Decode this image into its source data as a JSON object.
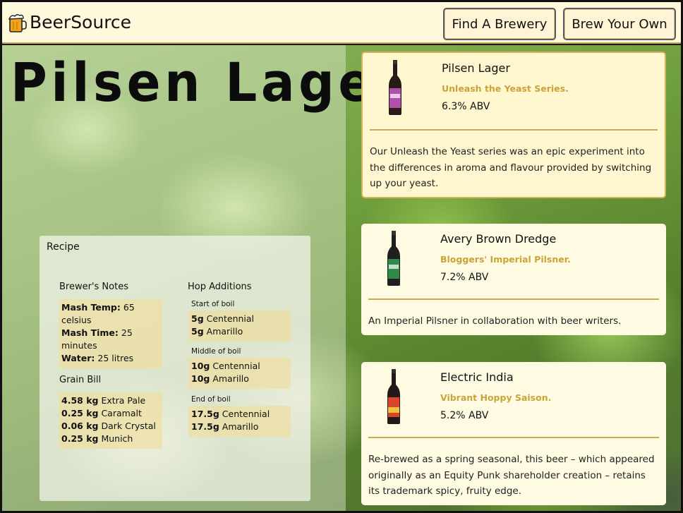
{
  "app": {
    "brand": "BeerSource",
    "logo_icon": "beer-mug-icon"
  },
  "nav": {
    "find_brewery": "Find A Brewery",
    "brew_your_own": "Brew Your Own"
  },
  "page": {
    "title": "Pilsen Lager"
  },
  "recipe": {
    "title": "Recipe",
    "brewers_notes": {
      "title": "Brewer's Notes",
      "mash_temp_label": "Mash Temp:",
      "mash_temp_value": "65 celsius",
      "mash_time_label": "Mash Time:",
      "mash_time_value": "25 minutes",
      "water_label": "Water:",
      "water_value": "25 litres"
    },
    "grain_bill": {
      "title": "Grain Bill",
      "items": [
        {
          "qty": "4.58 kg",
          "name": "Extra Pale"
        },
        {
          "qty": "0.25 kg",
          "name": "Caramalt"
        },
        {
          "qty": "0.06 kg",
          "name": "Dark Crystal"
        },
        {
          "qty": "0.25 kg",
          "name": "Munich"
        }
      ]
    },
    "hop_additions": {
      "title": "Hop Additions",
      "stages": [
        {
          "label": "Start of boil",
          "items": [
            {
              "qty": "5g",
              "name": "Centennial"
            },
            {
              "qty": "5g",
              "name": "Amarillo"
            }
          ]
        },
        {
          "label": "Middle of boil",
          "items": [
            {
              "qty": "10g",
              "name": "Centennial"
            },
            {
              "qty": "10g",
              "name": "Amarillo"
            }
          ]
        },
        {
          "label": "End of boil",
          "items": [
            {
              "qty": "17.5g",
              "name": "Centennial"
            },
            {
              "qty": "17.5g",
              "name": "Amarillo"
            }
          ]
        }
      ]
    }
  },
  "beers": [
    {
      "name": "Pilsen Lager",
      "subtitle": "Unleash the Yeast Series.",
      "abv": "6.3% ABV",
      "description": "Our Unleash the Yeast series was an epic experiment into the differences in aroma and flavour provided by switching up your yeast.",
      "label_color": "#b04fa8"
    },
    {
      "name": "Avery Brown Dredge",
      "subtitle": "Bloggers' Imperial Pilsner.",
      "abv": "7.2% ABV",
      "description": "An Imperial Pilsner in collaboration with beer writers.",
      "label_color": "#2f8a4a"
    },
    {
      "name": "Electric India",
      "subtitle": "Vibrant Hoppy Saison.",
      "abv": "5.2% ABV",
      "description": "Re-brewed as a spring seasonal, this beer – which appeared originally as an Equity Punk shareholder creation – retains its trademark spicy, fruity edge.",
      "label_color": "#d8472c"
    }
  ],
  "colors": {
    "header_bg": "#fff9dc",
    "accent_gold": "#c9a437",
    "card_bg": "#fffbe3"
  }
}
